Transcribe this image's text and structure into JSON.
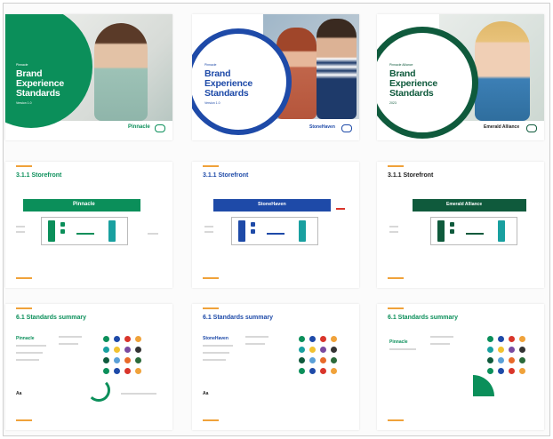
{
  "cards": {
    "c1": {
      "pre": "Pinnacle",
      "title": [
        "Brand",
        "Experience",
        "Standards"
      ],
      "sub": "Version 1.0",
      "logo": "Pinnacle"
    },
    "c2": {
      "pre": "Pinnacle",
      "title": [
        "Brand",
        "Experience",
        "Standards"
      ],
      "sub": "Version 1.0",
      "logo": "StoneHaven"
    },
    "c3": {
      "pre": "Pinnacle Alliance",
      "title": [
        "Brand",
        "Experience",
        "Standards"
      ],
      "sub": "2023",
      "logo": "Emerald Alliance"
    },
    "s1": {
      "title": "3.1.1 Storefront",
      "banner": "Pinnacle"
    },
    "s2": {
      "title": "3.1.1 Storefront",
      "banner": "StoneHaven"
    },
    "s3": {
      "title": "3.1.1 Storefront",
      "banner": "Emerald Alliance"
    },
    "t1": {
      "title": "6.1 Standards summary",
      "brand": "Pinnacle"
    },
    "t2": {
      "title": "6.1 Standards summary",
      "brand": "StoneHaven"
    },
    "t3": {
      "title": "6.1 Standards summary",
      "brand": "Pinnacle"
    }
  },
  "colors": {
    "green": "#0b8f5a",
    "blue": "#1e4aa8",
    "darkgreen": "#0f5a3c",
    "orange": "#f0a23a",
    "red": "#d9352b",
    "teal": "#19a0a0",
    "yellow": "#f2c230",
    "purple": "#7a4aa0"
  },
  "swatch_palette": [
    "#0b8f5a",
    "#1e4aa8",
    "#d9352b",
    "#f0a23a",
    "#19a0a0",
    "#f2c230",
    "#7a4aa0",
    "#333333",
    "#0f5a3c",
    "#5aa0d8",
    "#e86a2a",
    "#2a6a3a"
  ]
}
